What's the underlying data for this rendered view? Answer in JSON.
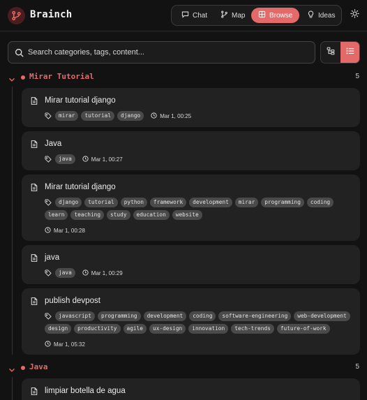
{
  "app": {
    "title": "Brainch"
  },
  "nav": {
    "items": [
      {
        "label": "Chat",
        "icon": "chat-bubble-icon"
      },
      {
        "label": "Map",
        "icon": "git-branch-icon"
      },
      {
        "label": "Browse",
        "icon": "grid-icon",
        "active": true
      },
      {
        "label": "Ideas",
        "icon": "lightbulb-icon"
      }
    ]
  },
  "search": {
    "placeholder": "Search categories, tags, content..."
  },
  "colors": {
    "accent": "#e46a6a",
    "background": "#121212",
    "card": "#222222",
    "tag": "#4a4a4a"
  },
  "categories": [
    {
      "name": "Mirar Tutorial",
      "count": "5",
      "notes": [
        {
          "title": "Mirar tutorial django",
          "tags": [
            "mirar",
            "tutorial",
            "django"
          ],
          "time": "Mar 1, 00:25"
        },
        {
          "title": "Java",
          "tags": [
            "java"
          ],
          "time": "Mar 1, 00:27"
        },
        {
          "title": "Mirar tutorial django",
          "tags": [
            "django",
            "tutorial",
            "python",
            "framework",
            "development",
            "mirar",
            "programming",
            "coding",
            "learn",
            "teaching",
            "study",
            "education",
            "website"
          ],
          "time": "Mar 1, 00:28"
        },
        {
          "title": "java",
          "tags": [
            "java"
          ],
          "time": "Mar 1, 00:29"
        },
        {
          "title": "publish devpost",
          "tags": [
            "javascript",
            "programming",
            "development",
            "coding",
            "software-engineering",
            "web-development",
            "design",
            "productivity",
            "agile",
            "ux-design",
            "innovation",
            "tech-trends",
            "future-of-work"
          ],
          "time": "Mar 1, 05:32"
        }
      ]
    },
    {
      "name": "Java",
      "count": "5",
      "notes": [
        {
          "title": "limpiar botella de agua"
        }
      ]
    }
  ]
}
